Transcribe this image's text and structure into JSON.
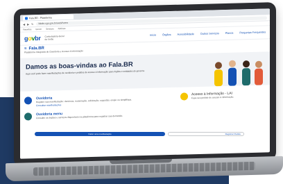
{
  "browser": {
    "tab_title": "Fala.BR - Plataforma",
    "url": "falabr.cgu.gov.br/web/home",
    "bookmarks": [
      "Favoritos",
      "Gov.br",
      "Serviços",
      "Notícias"
    ]
  },
  "header": {
    "logo": {
      "g": "g",
      "o": "o",
      "v": "v",
      "b": "b",
      "r": "r"
    },
    "org_line1": "Controladoria-Geral",
    "org_line2": "da União",
    "nav": [
      "Início",
      "Órgãos",
      "Acessibilidade",
      "Outros Serviços",
      "Planos",
      "Perguntas Frequentes"
    ]
  },
  "system": {
    "title": "Fala.BR",
    "subtitle": "Plataforma Integrada de Ouvidoria e Acesso à Informação"
  },
  "hero": {
    "title": "Damos as boas-vindas ao Fala.BR",
    "text": "Aqui você pode fazer manifestações de ouvidoria e pedidos de acesso à informação para órgãos e entidades do governo."
  },
  "cards": {
    "ouvidoria_title": "Ouvidoria",
    "ouvidoria_text": "Registre sua manifestação: denúncia, reclamação, solicitação, sugestão, elogio ou simplifique.",
    "ouvidoria_link": "Consultar manifestações",
    "second_title": "Ouvidoria menu",
    "second_text": "Consulte os órgãos e serviços disponíveis na plataforma para registrar sua demanda.",
    "acesso_title": "Acesso à Informação - LAI",
    "acesso_text": "Faça seu pedido de acesso à informação."
  },
  "buttons": {
    "primary": "Fazer uma manifestação",
    "secondary": "Registrar Pedido"
  },
  "colors": {
    "brand_blue": "#1351b4",
    "background_block": "#1f3a63",
    "accent_yellow": "#f5c400"
  }
}
